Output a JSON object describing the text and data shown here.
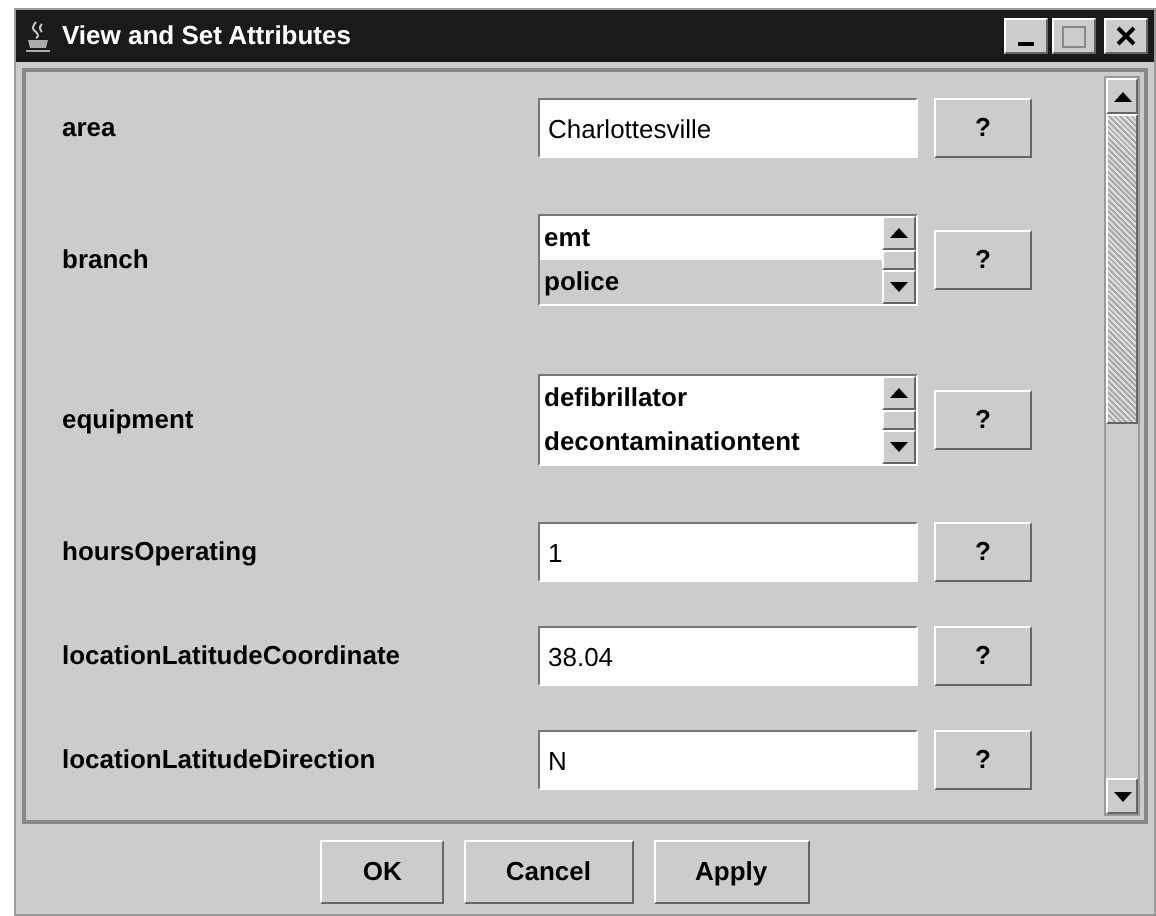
{
  "window": {
    "title": "View and Set Attributes"
  },
  "attributes": [
    {
      "kind": "text",
      "label": "area",
      "value": "Charlottesville",
      "help": "?"
    },
    {
      "kind": "list",
      "label": "branch",
      "items": [
        {
          "text": "emt",
          "selected": false
        },
        {
          "text": "police",
          "selected": true
        }
      ],
      "help": "?"
    },
    {
      "kind": "list",
      "label": "equipment",
      "items": [
        {
          "text": "defibrillator",
          "selected": false
        },
        {
          "text": "decontaminationtent",
          "selected": false
        }
      ],
      "help": "?"
    },
    {
      "kind": "text",
      "label": "hoursOperating",
      "value": "1",
      "help": "?"
    },
    {
      "kind": "text",
      "label": "locationLatitudeCoordinate",
      "value": "38.04",
      "help": "?"
    },
    {
      "kind": "text",
      "label": "locationLatitudeDirection",
      "value": "N",
      "help": "?"
    }
  ],
  "buttons": [
    "OK",
    "Cancel",
    "Apply"
  ]
}
